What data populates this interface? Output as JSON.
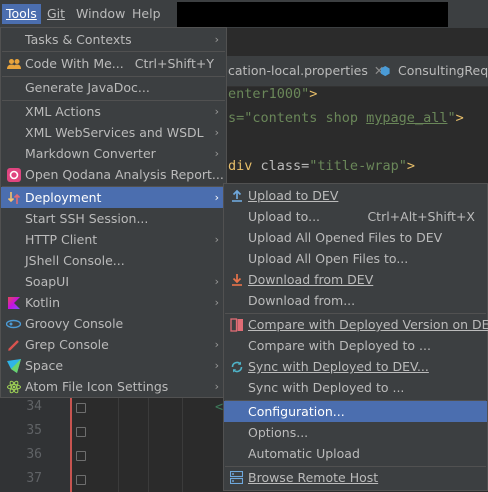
{
  "menubar": {
    "items": [
      {
        "label": "Tools",
        "mnemonic": "T"
      },
      {
        "label": "Git",
        "mnemonic": "G"
      },
      {
        "label": "Window",
        "mnemonic": "W"
      },
      {
        "label": "Help",
        "mnemonic": "H"
      }
    ]
  },
  "editor": {
    "tabs": [
      {
        "label": "cation-local.properties"
      },
      {
        "label": "ConsultingReque"
      }
    ],
    "code": {
      "line_a_str": "enter1000\"",
      "line_a_end": ">",
      "line_b_pre": "s=\"contents shop ",
      "line_b_under": "mypage_all",
      "line_b_post": "\"",
      "line_b_end": ">",
      "line_c_tag": "div",
      "line_c_attr": " class=",
      "line_c_str": "\"title-wrap\"",
      "line_c_end": ">",
      "tail_char": "<"
    },
    "line_numbers": [
      "34",
      "35",
      "36",
      "37"
    ]
  },
  "tools_menu": {
    "items": [
      {
        "label": "Tasks & Contexts",
        "submenu": true
      },
      {
        "label": "Code With Me...",
        "shortcut": "Ctrl+Shift+Y",
        "icon": "people-icon"
      },
      {
        "label": "Generate JavaDoc..."
      },
      {
        "label": "XML Actions",
        "submenu": true
      },
      {
        "label": "XML WebServices and WSDL",
        "submenu": true
      },
      {
        "label": "Markdown Converter",
        "submenu": true
      },
      {
        "label": "Open Qodana Analysis Report...",
        "icon": "qodana-icon"
      },
      {
        "label": "Deployment",
        "submenu": true,
        "icon": "deployment-icon",
        "selected": true
      },
      {
        "label": "Start SSH Session..."
      },
      {
        "label": "HTTP Client",
        "submenu": true
      },
      {
        "label": "JShell Console..."
      },
      {
        "label": "SoapUI",
        "submenu": true
      },
      {
        "label": "Kotlin",
        "submenu": true,
        "icon": "kotlin-icon"
      },
      {
        "label": "Groovy Console",
        "icon": "groovy-icon"
      },
      {
        "label": "Grep Console",
        "submenu": true,
        "icon": "grep-icon"
      },
      {
        "label": "Space",
        "submenu": true,
        "icon": "space-icon"
      },
      {
        "label": "Atom File Icon Settings",
        "submenu": true,
        "icon": "atom-icon"
      }
    ]
  },
  "deployment_menu": {
    "items": [
      {
        "label": "Upload to DEV",
        "icon": "upload-icon"
      },
      {
        "label": "Upload to...",
        "shortcut": "Ctrl+Alt+Shift+X"
      },
      {
        "label": "Upload All Opened Files to DEV"
      },
      {
        "label": "Upload All Open Files to..."
      },
      {
        "label": "Download from DEV",
        "icon": "download-icon"
      },
      {
        "label": "Download from..."
      },
      {
        "label": "Compare with Deployed Version on DEV",
        "icon": "compare-icon"
      },
      {
        "label": "Compare with Deployed to ..."
      },
      {
        "label": "Sync with Deployed to DEV...",
        "icon": "sync-icon"
      },
      {
        "label": "Sync with Deployed to ..."
      },
      {
        "label": "Configuration...",
        "selected": true
      },
      {
        "label": "Options..."
      },
      {
        "label": "Automatic Upload"
      },
      {
        "label": "Browse Remote Host",
        "icon": "browse-remote-icon"
      }
    ]
  },
  "colors": {
    "menu_bg": "#3c3f41",
    "selection": "#4b6eaf",
    "editor_bg": "#2b2b2b"
  }
}
